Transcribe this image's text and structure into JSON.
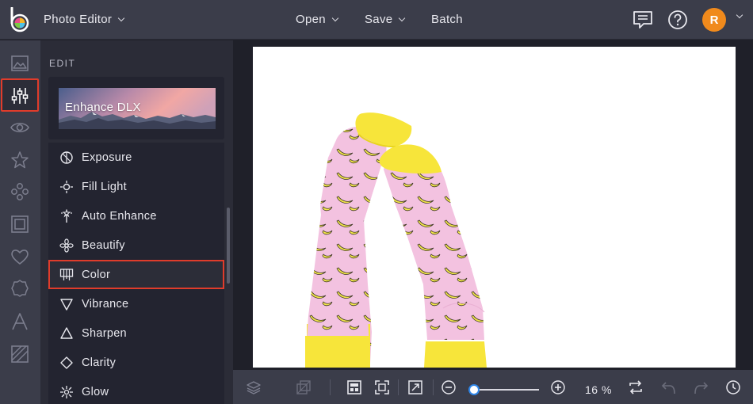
{
  "header": {
    "app_title": "Photo Editor",
    "menu_open": "Open",
    "menu_save": "Save",
    "menu_batch": "Batch",
    "avatar_initial": "R"
  },
  "rail": {
    "icons": [
      "image-icon",
      "sliders-icon",
      "eye-icon",
      "star-icon",
      "overlay-icon",
      "frame-icon",
      "heart-icon",
      "texture-icon",
      "text-icon",
      "graphics-icon"
    ],
    "selected": "sliders-icon"
  },
  "panel": {
    "section_label": "EDIT",
    "enhance_card_label": "Enhance DLX",
    "items": [
      {
        "label": "Exposure",
        "icon": "exposure-icon"
      },
      {
        "label": "Fill Light",
        "icon": "fill-light-icon"
      },
      {
        "label": "Auto Enhance",
        "icon": "auto-enhance-icon"
      },
      {
        "label": "Beautify",
        "icon": "beautify-icon"
      },
      {
        "label": "Color",
        "icon": "color-icon"
      },
      {
        "label": "Vibrance",
        "icon": "vibrance-icon"
      },
      {
        "label": "Sharpen",
        "icon": "sharpen-icon"
      },
      {
        "label": "Clarity",
        "icon": "clarity-icon"
      },
      {
        "label": "Glow",
        "icon": "glow-icon"
      }
    ],
    "selected_item": "Color"
  },
  "bottombar": {
    "zoom_value": "16 %",
    "zoom_fraction": 0.0
  },
  "colors": {
    "accent_selection": "#e03c2b",
    "avatar_bg": "#f08a1c",
    "slider_knob_border": "#2f86e8"
  }
}
